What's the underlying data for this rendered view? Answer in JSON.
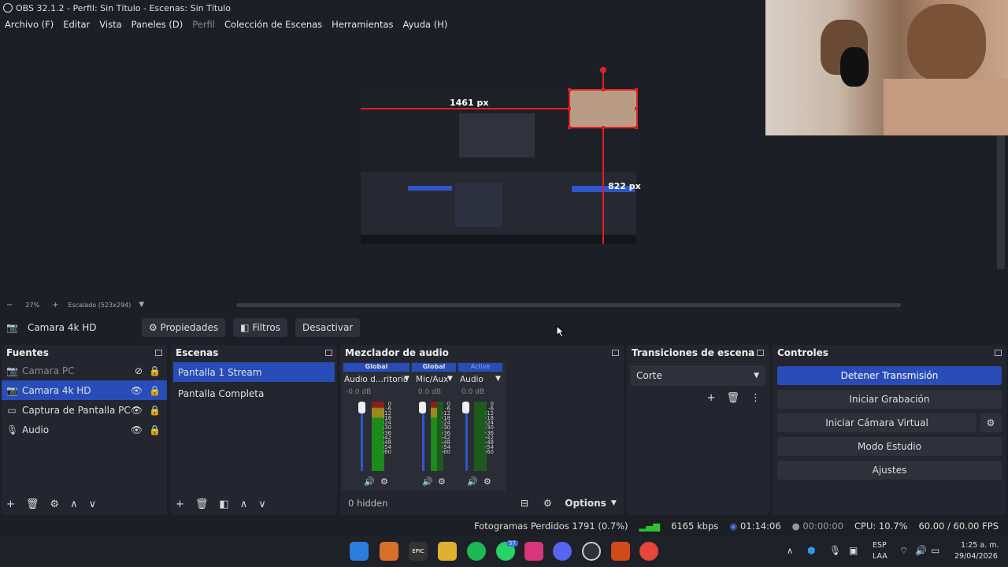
{
  "window": {
    "title": "OBS 32.1.2 - Perfil: Sin Título - Escenas: Sin Título"
  },
  "menu": [
    {
      "label": "Archivo (F)",
      "disabled": false
    },
    {
      "label": "Editar",
      "disabled": false
    },
    {
      "label": "Vista",
      "disabled": false
    },
    {
      "label": "Paneles (D)",
      "disabled": false
    },
    {
      "label": "Perfil",
      "disabled": true
    },
    {
      "label": "Colección de Escenas",
      "disabled": false
    },
    {
      "label": "Herramientas",
      "disabled": false
    },
    {
      "label": "Ayuda (H)",
      "disabled": false
    }
  ],
  "preview": {
    "width_label": "1461 px",
    "height_label": "822 px"
  },
  "zoom": {
    "minus": "−",
    "value": "27%",
    "plus": "+",
    "scale": "Escalado (523x294)"
  },
  "source_toolbar": {
    "source": "Camara 4k HD",
    "properties": "Propiedades",
    "filters": "Filtros",
    "deactivate": "Desactivar"
  },
  "sources": {
    "title": "Fuentes",
    "items": [
      {
        "label": "Camara PC",
        "icon": "camera-icon",
        "visible": false,
        "selected": false
      },
      {
        "label": "Camara 4k HD",
        "icon": "camera-icon",
        "visible": true,
        "selected": true
      },
      {
        "label": "Captura de Pantalla PC",
        "icon": "monitor-icon",
        "visible": true,
        "selected": false
      },
      {
        "label": "Audio",
        "icon": "microphone-icon",
        "visible": true,
        "selected": false
      }
    ]
  },
  "scenes": {
    "title": "Escenas",
    "items": [
      {
        "label": "Pantalla 1 Stream",
        "selected": true
      },
      {
        "label": "Pantalla Completa",
        "selected": false
      }
    ]
  },
  "mixer": {
    "title": "Mezclador de audio",
    "channels": [
      {
        "tag": "Global",
        "name": "Audio d...ritorio",
        "db": "-0.0 dB"
      },
      {
        "tag": "Global",
        "name": "Mic/Aux",
        "db": "0.0 dB"
      },
      {
        "tag": "Active",
        "name": "Audio",
        "db": "0.0 dB"
      }
    ],
    "scale": [
      "0",
      "-6",
      "-12",
      "-18",
      "-24",
      "-30",
      "-36",
      "-42",
      "-48",
      "-54",
      "-60"
    ],
    "hidden": "0 hidden",
    "options": "Options"
  },
  "transitions": {
    "title": "Transiciones de escena",
    "selected": "Corte"
  },
  "controls": {
    "title": "Controles",
    "stop_stream": "Detener Transmisión",
    "start_recording": "Iniciar Grabación",
    "virtual_cam": "Iniciar Cámara Virtual",
    "studio_mode": "Modo Estudio",
    "settings": "Ajustes"
  },
  "status": {
    "dropped": "Fotogramas Perdidos 1791 (0.7%)",
    "bitrate": "6165 kbps",
    "stream_time": "01:14:06",
    "rec_time": "00:00:00",
    "cpu": "CPU: 10.7%",
    "fps": "60.00 / 60.00 FPS"
  },
  "taskbar": {
    "lang": "ESP",
    "layout": "LAA",
    "time": "1:25 a. m.",
    "date": "29/04/2026",
    "whatsapp_badge": "57"
  },
  "colors": {
    "accent": "#284cb8",
    "bg": "#1d1f26",
    "dock": "#23262e"
  }
}
